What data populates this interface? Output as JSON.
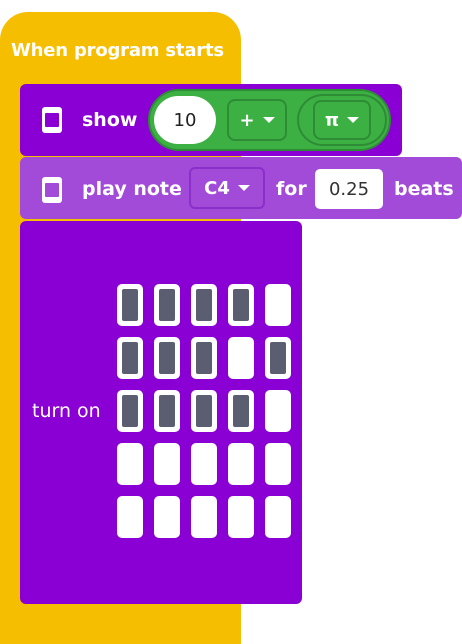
{
  "hat": {
    "title": "When program starts",
    "color": "#F5BE00"
  },
  "show_block": {
    "label": "show",
    "number": "10",
    "operator": "+",
    "constant": "π"
  },
  "note_block": {
    "label_play": "play note",
    "note": "C4",
    "label_for": "for",
    "beats_value": "0.25",
    "label_beats": "beats"
  },
  "turnon_block": {
    "label": "turn on",
    "grid": [
      [
        1,
        1,
        1,
        1,
        0
      ],
      [
        1,
        1,
        1,
        0,
        1
      ],
      [
        1,
        1,
        1,
        1,
        0
      ],
      [
        0,
        0,
        0,
        0,
        0
      ],
      [
        0,
        0,
        0,
        0,
        0
      ]
    ]
  },
  "colors": {
    "purple": "#8A00D4",
    "purple_light": "#A24BD8",
    "green": "#3CB043",
    "led_on": "#5B5E70",
    "led_off": "#FFFFFF"
  },
  "icons": {
    "device_icon": "microbit-icon",
    "dropdown_icon": "caret-down-icon"
  }
}
